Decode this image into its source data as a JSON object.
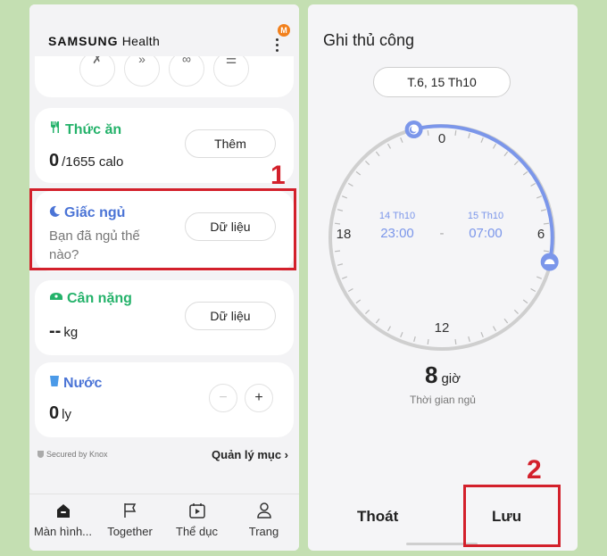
{
  "left": {
    "brand": {
      "name": "SAMSUNG",
      "suffix": "Health"
    },
    "badge": "M",
    "shortcuts": [
      "✗",
      "»",
      "∞",
      "☰"
    ],
    "food": {
      "title": "Thức ăn",
      "value": "0",
      "unit": "/1655 calo",
      "button": "Thêm"
    },
    "sleep": {
      "title": "Giấc ngủ",
      "question": "Bạn đã ngủ thế nào?",
      "button": "Dữ liệu"
    },
    "weight": {
      "title": "Cân nặng",
      "value": "--",
      "unit": "kg",
      "button": "Dữ liệu"
    },
    "water": {
      "title": "Nước",
      "value": "0",
      "unit": "ly",
      "minus": "−",
      "plus": "+"
    },
    "knox": "Secured by Knox",
    "manage": "Quản lý mục  ›",
    "nav": [
      "Màn hình...",
      "Together",
      "Thể dục",
      "Trang"
    ]
  },
  "right": {
    "title": "Ghi thủ công",
    "date": "T.6, 15 Th10",
    "clock": {
      "labels": {
        "top": "0",
        "right": "6",
        "bottom": "12",
        "left": "18"
      },
      "start": {
        "date": "14 Th10",
        "time": "23:00"
      },
      "separator": "-",
      "end": {
        "date": "15 Th10",
        "time": "07:00"
      }
    },
    "duration": {
      "value": "8",
      "unit": "giờ",
      "label": "Thời gian ngủ"
    },
    "cancel": "Thoát",
    "save": "Lưu"
  },
  "annotations": {
    "step1": "1",
    "step2": "2"
  },
  "colors": {
    "green": "#24b26a",
    "blue": "#4b74d6",
    "arc": "#7b96ea",
    "highlight": "#d3202b"
  },
  "icons": [
    "fork-knife-icon",
    "moon-icon",
    "scale-icon",
    "cup-icon",
    "home-icon",
    "flag-icon",
    "calendar-play-icon",
    "person-icon",
    "shield-icon",
    "sun-icon",
    "more-icon"
  ]
}
